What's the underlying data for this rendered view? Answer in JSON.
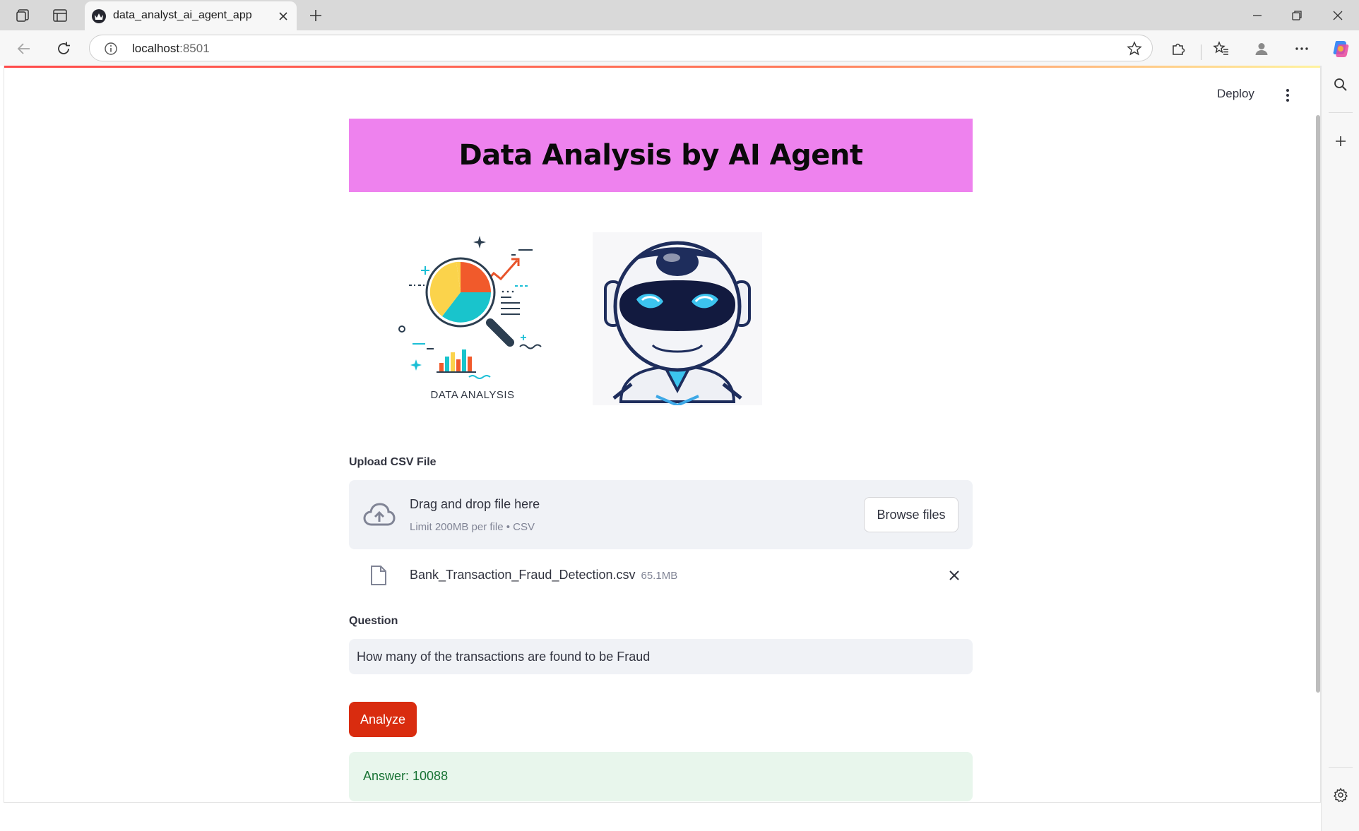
{
  "browser": {
    "tab_title": "data_analyst_ai_agent_app",
    "url_host": "localhost",
    "url_port": ":8501"
  },
  "app": {
    "deploy_label": "Deploy",
    "title": "Data Analysis by AI Agent",
    "image_caption_data_analysis": "DATA ANALYSIS",
    "accent_color": "#ee82ee",
    "primary_color": "#d92c0f"
  },
  "uploader": {
    "label": "Upload CSV File",
    "drop_title": "Drag and drop file here",
    "drop_limit": "Limit 200MB per file • CSV",
    "browse_label": "Browse files",
    "file_name": "Bank_Transaction_Fraud_Detection.csv",
    "file_size": "65.1MB"
  },
  "question": {
    "label": "Question",
    "value": "How many of the transactions are found to be Fraud"
  },
  "analyze": {
    "label": "Analyze"
  },
  "answer": {
    "text": "Answer: 10088"
  },
  "icons": [
    "workspaces-icon",
    "tab-actions-icon",
    "streamlit-favicon-icon",
    "close-icon",
    "plus-icon",
    "minimize-icon",
    "restore-icon",
    "back-icon",
    "reload-icon",
    "info-icon",
    "star-icon",
    "extensions-icon",
    "favorites-icon",
    "profile-icon",
    "more-icon",
    "copilot-icon",
    "search-icon",
    "gear-icon",
    "cloud-upload-icon",
    "file-icon",
    "kebab-menu-icon"
  ]
}
